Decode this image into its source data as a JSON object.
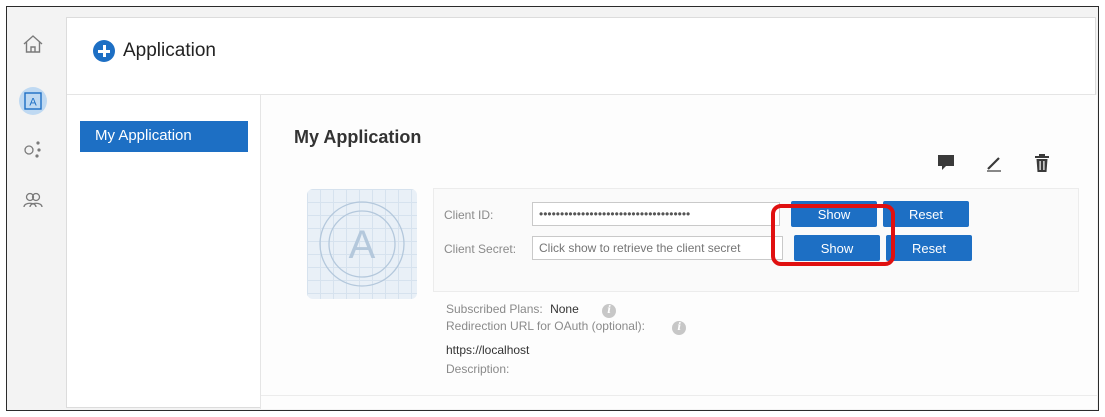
{
  "header": {
    "title": "Application"
  },
  "sidebar": {
    "items": [
      {
        "label": "My Application"
      }
    ]
  },
  "rail": {
    "icons": [
      "home-icon",
      "apps-icon",
      "share-icon",
      "users-icon"
    ]
  },
  "app": {
    "title": "My Application",
    "logo_letter": "A",
    "toolbar": [
      "comment-icon",
      "edit-icon",
      "trash-icon"
    ],
    "client_id": {
      "label": "Client ID:",
      "value": "••••••••••••••••••••••••••••••••••••",
      "show_label": "Show",
      "reset_label": "Reset"
    },
    "client_secret": {
      "label": "Client Secret:",
      "placeholder": "Click show to retrieve the client secret",
      "show_label": "Show",
      "reset_label": "Reset"
    },
    "subscribed_plans": {
      "label": "Subscribed Plans:",
      "value": "None"
    },
    "redirection_url": {
      "label": "Redirection URL for OAuth (optional):",
      "value": "https://localhost"
    },
    "description": {
      "label": "Description:"
    }
  },
  "colors": {
    "accent": "#1d6fc4",
    "highlight": "#e01010"
  }
}
